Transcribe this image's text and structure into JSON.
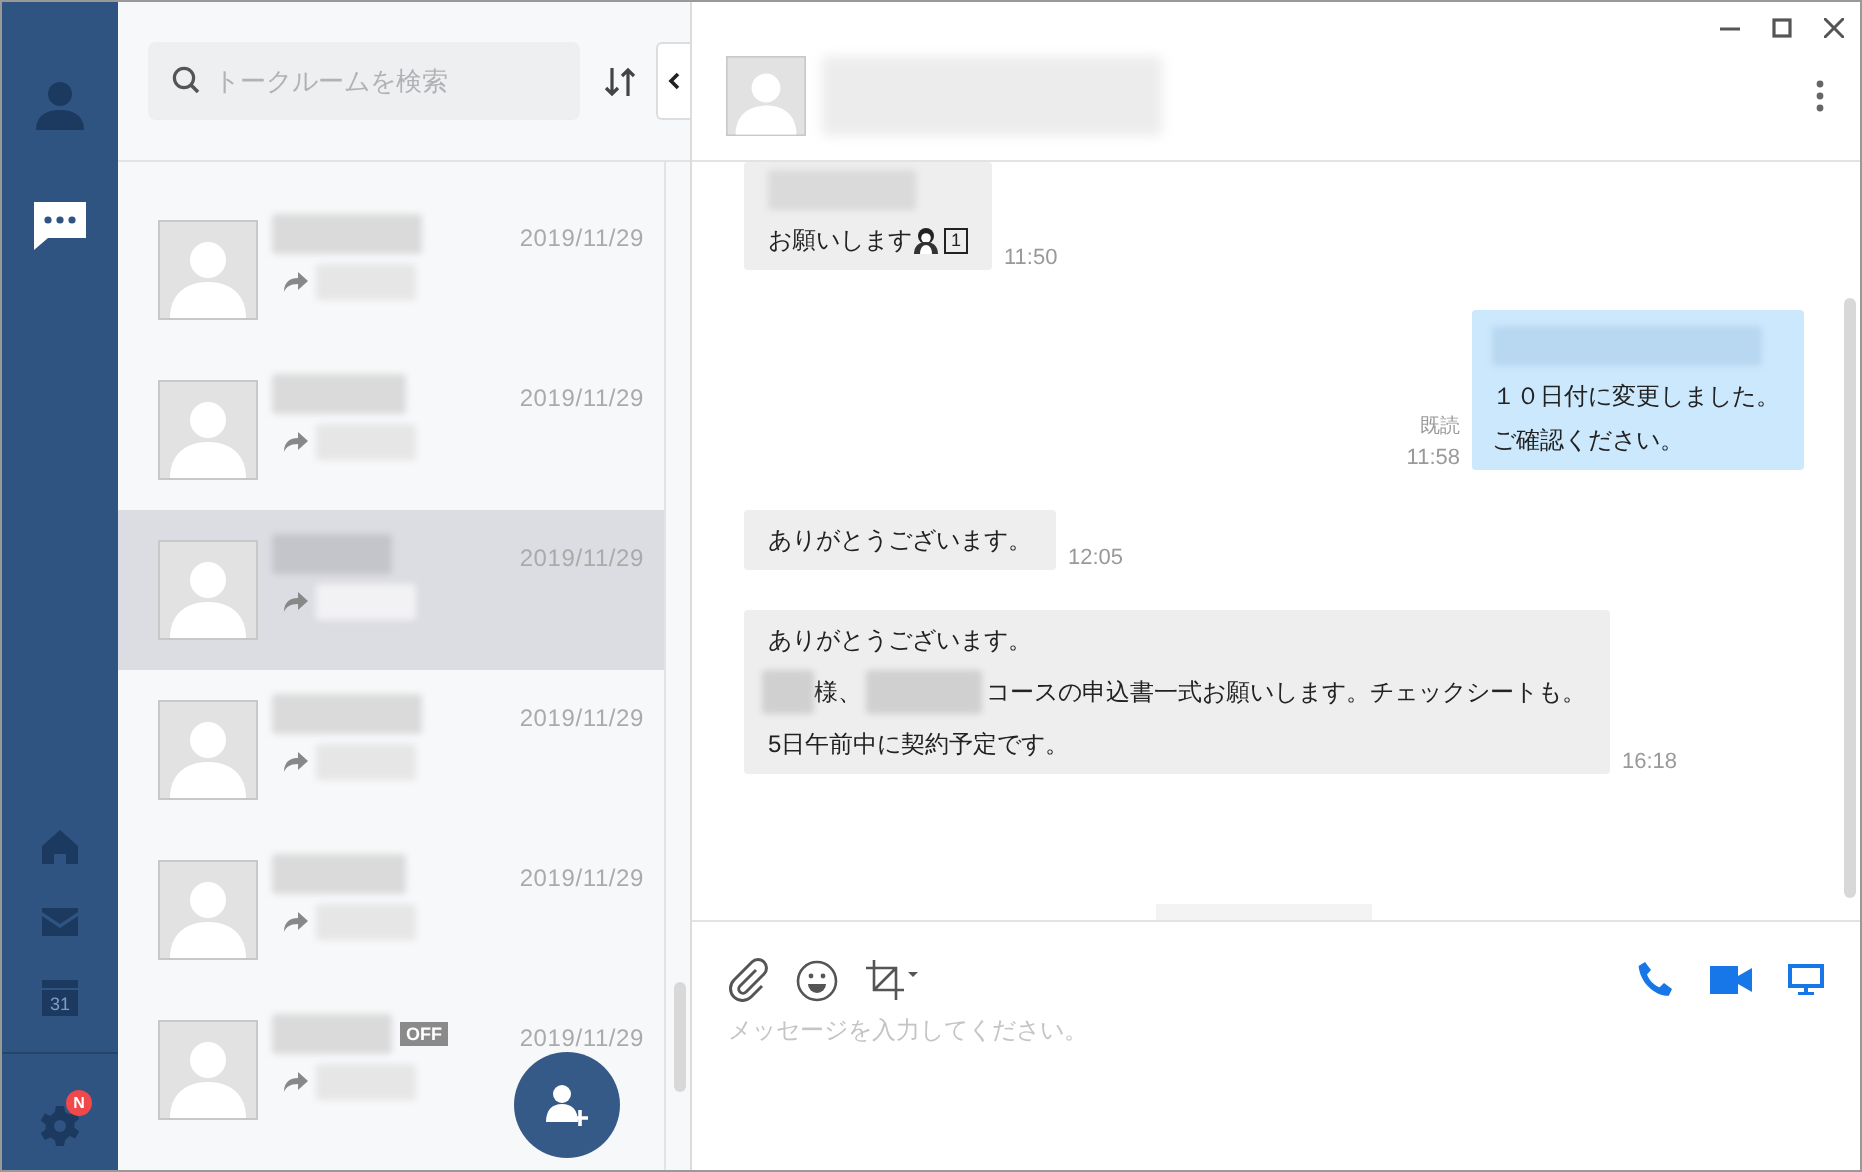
{
  "nav": {
    "top": [
      {
        "kind": "profile",
        "selected": false
      },
      {
        "kind": "chat",
        "selected": true
      }
    ],
    "bottom": [
      {
        "kind": "home"
      },
      {
        "kind": "mail"
      },
      {
        "kind": "calendar",
        "label": "31"
      }
    ],
    "settings": {
      "badge": "N"
    }
  },
  "list": {
    "search": {
      "placeholder": "トークルームを検索"
    },
    "rooms": [
      {
        "date": "2019/11/29",
        "selected": false
      },
      {
        "date": "2019/11/29",
        "selected": false
      },
      {
        "date": "2019/11/29",
        "selected": true
      },
      {
        "date": "2019/11/29",
        "selected": false
      },
      {
        "date": "2019/11/29",
        "selected": false
      },
      {
        "date": "2019/11/29",
        "selected": false,
        "badge": "OFF"
      }
    ]
  },
  "chat": {
    "messages": [
      {
        "kind": "incoming",
        "sender_hidden": true,
        "lines": [
          [
            {
              "kind": "text",
              "text": "お願いします"
            },
            {
              "kind": "emoji"
            },
            {
              "kind": "keycap",
              "text": "1"
            }
          ]
        ],
        "time": "11:50"
      },
      {
        "kind": "outgoing",
        "sender_hidden": true,
        "lines": [
          [
            {
              "kind": "text",
              "text": "１０日付に変更しました。"
            }
          ],
          [
            {
              "kind": "text",
              "text": "ご確認ください。"
            }
          ]
        ],
        "read": "既読",
        "time": "11:58"
      },
      {
        "kind": "incoming",
        "sender_hidden": false,
        "lines": [
          [
            {
              "kind": "text",
              "text": "ありがとうございます。"
            }
          ]
        ],
        "time": "12:05"
      },
      {
        "kind": "incoming",
        "sender_hidden": false,
        "lines": [
          [
            {
              "kind": "text",
              "text": "ありがとうございます。"
            }
          ],
          [
            {
              "kind": "blurshort"
            },
            {
              "kind": "text",
              "text": "様、"
            },
            {
              "kind": "blurlong"
            },
            {
              "kind": "text",
              "text": "コースの申込書一式お願いします。チェックシートも。"
            }
          ],
          [
            {
              "kind": "text",
              "text": "5日午前中に契約予定です。"
            }
          ]
        ],
        "time": "16:18"
      }
    ],
    "composer": {
      "placeholder": "メッセージを入力してください。"
    }
  }
}
